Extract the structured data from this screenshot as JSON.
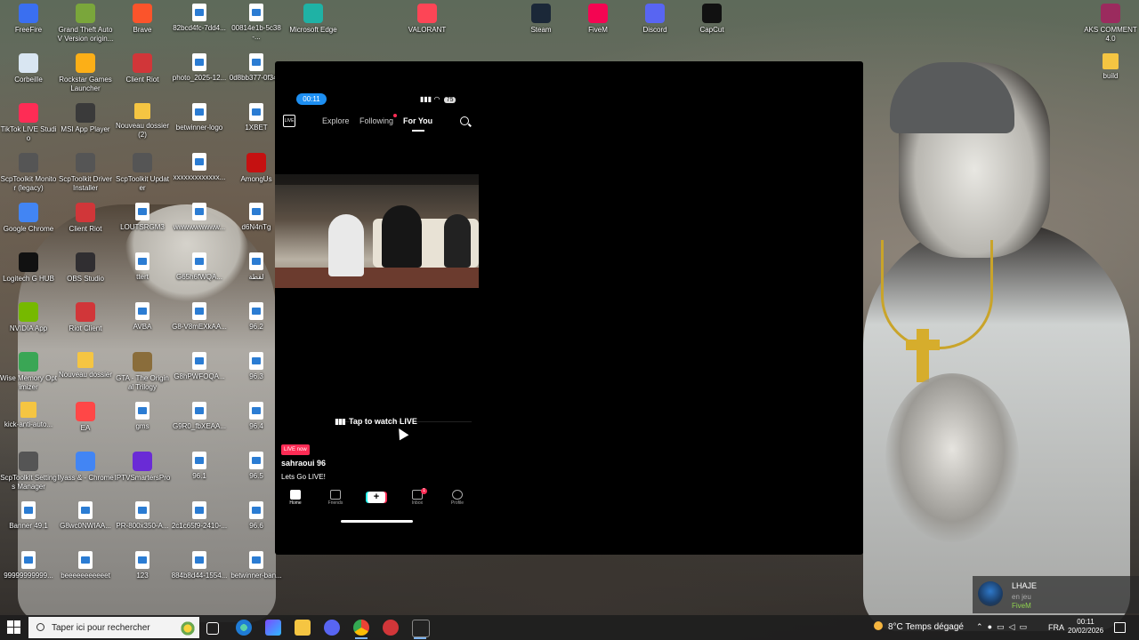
{
  "desktop": {
    "icons": [
      {
        "label": "FreeFire",
        "icon": "freefire-icon",
        "color": "#3a6ff0"
      },
      {
        "label": "Grand Theft Auto V Version origin...",
        "icon": "gta5-icon",
        "color": "#7aa63b"
      },
      {
        "label": "Brave",
        "icon": "brave-icon",
        "color": "#fb542b"
      },
      {
        "label": "82bcd4fc-7dd4...",
        "icon": "image-file-icon",
        "color": "#ffffff"
      },
      {
        "label": "00814e1b-5c38-...",
        "icon": "image-file-icon",
        "color": "#ffffff"
      },
      {
        "label": "Microsoft Edge",
        "icon": "edge-icon",
        "color": "#1fb2a5"
      },
      {
        "label": "VALORANT",
        "icon": "valorant-icon",
        "color": "#fd4556"
      },
      {
        "label": "Steam",
        "icon": "steam-icon",
        "color": "#1b2838"
      },
      {
        "label": "FiveM",
        "icon": "fivem-icon",
        "color": "#f40552"
      },
      {
        "label": "Discord",
        "icon": "discord-icon",
        "color": "#5865f2"
      },
      {
        "label": "CapCut",
        "icon": "capcut-icon",
        "color": "#111111"
      },
      {
        "label": "AKS COMMENT 4.0",
        "icon": "winrar-icon",
        "color": "#9b2b5e"
      },
      {
        "label": "Corbeille",
        "icon": "recycle-bin-icon",
        "color": "#d9e6f2"
      },
      {
        "label": "Rockstar Games Launcher",
        "icon": "rockstar-icon",
        "color": "#fcaf17"
      },
      {
        "label": "Client Riot",
        "icon": "riot-icon",
        "color": "#d13639"
      },
      {
        "label": "photo_2025-12...",
        "icon": "image-file-icon",
        "color": "#ffffff"
      },
      {
        "label": "0d8bb377-0f34...",
        "icon": "image-file-icon",
        "color": "#ffffff"
      },
      {
        "label": "build",
        "icon": "folder-icon",
        "color": "#f5c542"
      },
      {
        "label": "TikTok LIVE Studio",
        "icon": "tiktok-live-icon",
        "color": "#fe2c55"
      },
      {
        "label": "MSI App Player",
        "icon": "msi-icon",
        "color": "#3a3a3a"
      },
      {
        "label": "Nouveau dossier (2)",
        "icon": "folder-icon",
        "color": "#f5c542"
      },
      {
        "label": "betwinner-logo",
        "icon": "image-file-icon",
        "color": "#ffffff"
      },
      {
        "label": "1XBET",
        "icon": "image-file-icon",
        "color": "#ffffff"
      },
      {
        "label": "ScpToolkit Monitor (legacy)",
        "icon": "scptoolkit-icon",
        "color": "#555555"
      },
      {
        "label": "ScpToolkit Driver Installer",
        "icon": "scptoolkit-icon",
        "color": "#555555"
      },
      {
        "label": "ScpToolkit Updater",
        "icon": "scptoolkit-icon",
        "color": "#555555"
      },
      {
        "label": "xxxxxxxxxxxxx...",
        "icon": "image-file-icon",
        "color": "#ffffff"
      },
      {
        "label": "AmongUs",
        "icon": "amongus-icon",
        "color": "#c51111"
      },
      {
        "label": "Google Chrome",
        "icon": "chrome-icon",
        "color": "#4285f4"
      },
      {
        "label": "Client Riot",
        "icon": "riot-icon",
        "color": "#d13639"
      },
      {
        "label": "LOUTSRGM3",
        "icon": "image-file-icon",
        "color": "#ffffff"
      },
      {
        "label": "wwwwwwwww...",
        "icon": "image-file-icon",
        "color": "#ffffff"
      },
      {
        "label": "d6N4nTg",
        "icon": "image-file-icon",
        "color": "#ffffff"
      },
      {
        "label": "Logitech G HUB",
        "icon": "logitech-icon",
        "color": "#111111"
      },
      {
        "label": "OBS Studio",
        "icon": "obs-icon",
        "color": "#302e31"
      },
      {
        "label": "ttert",
        "icon": "image-file-icon",
        "color": "#ffffff"
      },
      {
        "label": "G65h6fWQA...",
        "icon": "image-file-icon",
        "color": "#ffffff"
      },
      {
        "label": "لقطة",
        "icon": "image-file-icon",
        "color": "#ffffff"
      },
      {
        "label": "NVIDIA App",
        "icon": "nvidia-icon",
        "color": "#76b900"
      },
      {
        "label": "Riot Client",
        "icon": "riot-icon",
        "color": "#d13639"
      },
      {
        "label": "AVBA",
        "icon": "image-file-icon",
        "color": "#ffffff"
      },
      {
        "label": "G8-V8mEXkAA...",
        "icon": "image-file-icon",
        "color": "#ffffff"
      },
      {
        "label": "96.2",
        "icon": "image-file-icon",
        "color": "#ffffff"
      },
      {
        "label": "Wise Memory Optimizer",
        "icon": "wise-memory-icon",
        "color": "#3aa655"
      },
      {
        "label": "Nouveau dossier",
        "icon": "folder-icon",
        "color": "#f5c542"
      },
      {
        "label": "GTA - The Original Trilogy",
        "icon": "gta-trilogy-icon",
        "color": "#8a6d3b"
      },
      {
        "label": "G8hPWFOQA...",
        "icon": "image-file-icon",
        "color": "#ffffff"
      },
      {
        "label": "96.3",
        "icon": "image-file-icon",
        "color": "#ffffff"
      },
      {
        "label": "kick-anti-auto...",
        "icon": "folder-icon",
        "color": "#f5c542"
      },
      {
        "label": "EA",
        "icon": "ea-icon",
        "color": "#ff4747"
      },
      {
        "label": "gms",
        "icon": "image-file-icon",
        "color": "#ffffff"
      },
      {
        "label": "G9R0_fbXEAA...",
        "icon": "image-file-icon",
        "color": "#ffffff"
      },
      {
        "label": "96.4",
        "icon": "image-file-icon",
        "color": "#ffffff"
      },
      {
        "label": "ScpToolkit Settings Manager",
        "icon": "scptoolkit-icon",
        "color": "#555555"
      },
      {
        "label": "Ilyass & - Chrome",
        "icon": "chrome-icon",
        "color": "#4285f4"
      },
      {
        "label": "IPTVSmartersPro",
        "icon": "iptv-icon",
        "color": "#6a2bd6"
      },
      {
        "label": "96.1",
        "icon": "image-file-icon",
        "color": "#ffffff"
      },
      {
        "label": "96.5",
        "icon": "image-file-icon",
        "color": "#ffffff"
      },
      {
        "label": "Banner 49.1",
        "icon": "image-file-icon",
        "color": "#ffffff"
      },
      {
        "label": "G8wc0NWIAA...",
        "icon": "image-file-icon",
        "color": "#ffffff"
      },
      {
        "label": "PR-800x350-A...",
        "icon": "image-file-icon",
        "color": "#ffffff"
      },
      {
        "label": "2c1c65f9-2410-...",
        "icon": "image-file-icon",
        "color": "#ffffff"
      },
      {
        "label": "96.6",
        "icon": "image-file-icon",
        "color": "#ffffff"
      },
      {
        "label": "99999999999...",
        "icon": "image-file-icon",
        "color": "#ffffff"
      },
      {
        "label": "beeeeeeeeeeet",
        "icon": "image-file-icon",
        "color": "#ffffff"
      },
      {
        "label": "123",
        "icon": "image-file-icon",
        "color": "#ffffff"
      },
      {
        "label": "884b8d44-1554...",
        "icon": "image-file-icon",
        "color": "#ffffff"
      },
      {
        "label": "betwinner-ban...",
        "icon": "image-file-icon",
        "color": "#ffffff"
      }
    ]
  },
  "tiktok": {
    "status_time": "00:11",
    "battery": "75",
    "nav": {
      "live": "LIVE",
      "explore": "Explore",
      "following": "Following",
      "for_you": "For You"
    },
    "tap_to_watch": "Tap to watch LIVE",
    "live_badge": "LIVE now",
    "username": "sahraoui 96",
    "caption": "Lets Go LIVE!",
    "bottom_nav": {
      "home": "Home",
      "friends": "Friends",
      "inbox": "Inbox",
      "profile": "Profile",
      "inbox_badge": "1",
      "plus": "+"
    },
    "accent": "#fe2c55"
  },
  "notification": {
    "name": "LHAJE",
    "status": "en jeu",
    "game": "FiveM"
  },
  "taskbar": {
    "search_placeholder": "Taper ici pour rechercher",
    "weather": "8°C  Temps dégagé",
    "language": "FRA",
    "time": "00:11",
    "date": "20/02/2026"
  }
}
